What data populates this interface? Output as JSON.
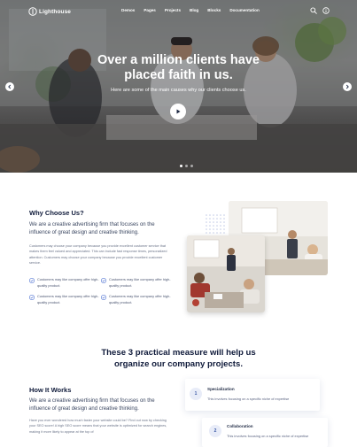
{
  "nav": {
    "logo": "Lighthouse",
    "menu": [
      "Demos",
      "Pages",
      "Projects",
      "Blog",
      "Blocks",
      "Documentation"
    ]
  },
  "hero": {
    "title": "Over a million clients have placed faith in us.",
    "subtitle": "Here are some of the main causes why our clients choose us.",
    "slide_count": 3,
    "active_slide": 1
  },
  "why": {
    "title": "Why Choose Us?",
    "lead": "We are a creative advertising firm that focuses on the influence of great design and creative thinking.",
    "body": "Customers may choose your company because you provide excellent customer service that makes them feel valued and appreciated. This can include fast response times, personalized attention. Customers may choose your company because you provide excellent customer service.",
    "checks": [
      "Customers may like company offer high-quality product.",
      "Customers may like company offer high-quality product.",
      "Customers may like company offer high-quality product.",
      "Customers may like company offer high-quality product."
    ]
  },
  "measures": {
    "title": "These 3 practical measure will help us organize our company projects.",
    "how_title": "How It Works",
    "how_lead": "We are a creative advertising firm that focuses on the influence of great design and creative thinking.",
    "how_body": "Have you ever wondered how much faster your website could be? Find out now by checking your SEO score! A high SEO score means that your website is optimized for search engines, making it more likely to appear at the top of",
    "steps": [
      {
        "num": "1",
        "title": "Specialization",
        "desc": "This involves focusing on a specific niche of expertise"
      },
      {
        "num": "2",
        "title": "Collaboration",
        "desc": "This involves focusing on a specific niche of expertise"
      }
    ]
  },
  "colors": {
    "accent": "#3c5aa6",
    "check": "#4a6fd1",
    "heading": "#0f1a3a"
  }
}
